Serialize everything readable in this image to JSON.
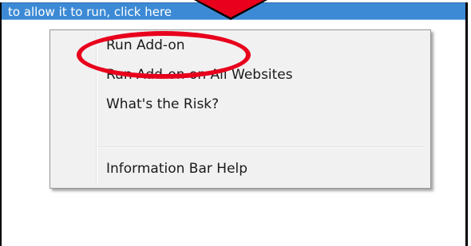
{
  "info_bar": {
    "text": "to allow it to run, click here"
  },
  "context_menu": {
    "items": [
      {
        "label": "Run Add-on"
      },
      {
        "label": "Run Add-on on All Websites"
      },
      {
        "label": "What's the Risk?"
      },
      {
        "label": "Information Bar Help"
      }
    ]
  },
  "annotation": {
    "highlight_color": "#e8001c",
    "highlighted_item": "Run Add-on"
  },
  "colors": {
    "info_bar_bg": "#3c8ad5",
    "menu_bg": "#f1f1f1",
    "menu_border": "#979797"
  }
}
